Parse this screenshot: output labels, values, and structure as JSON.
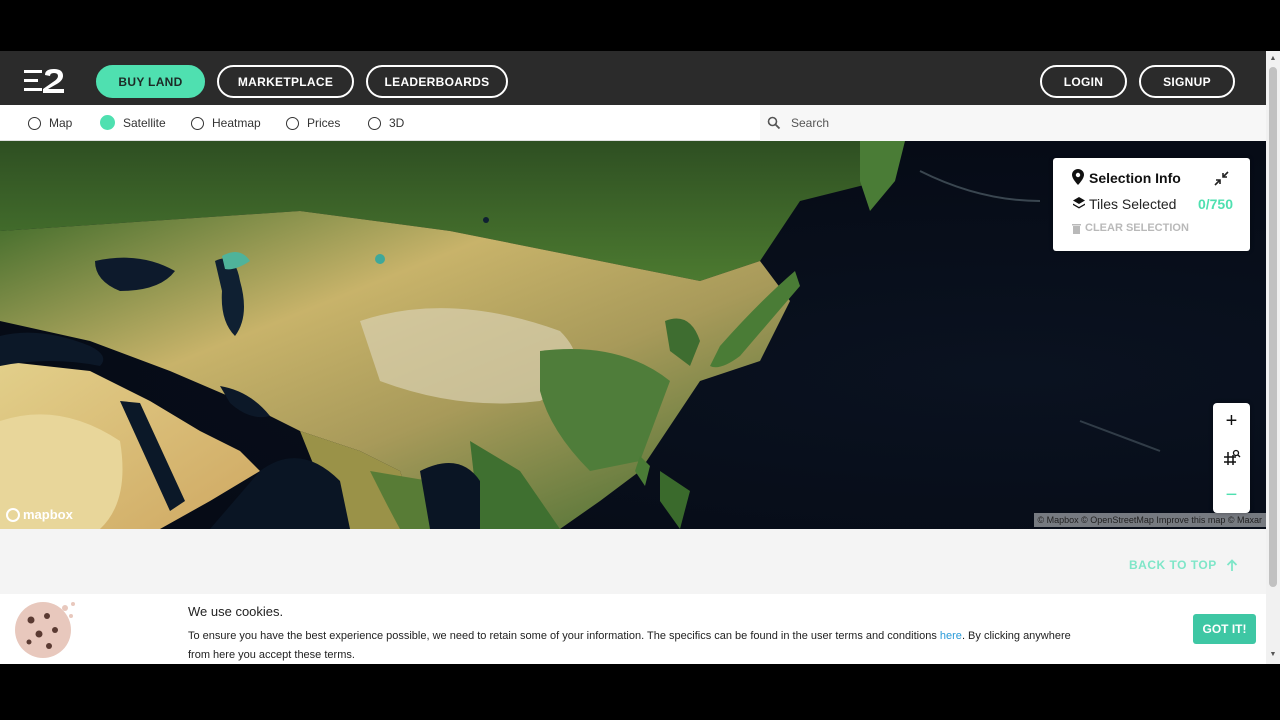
{
  "header": {
    "logo_icon": "e2-logo-icon",
    "nav": [
      {
        "label": "BUY LAND"
      },
      {
        "label": "MARKETPLACE"
      },
      {
        "label": "LEADERBOARDS"
      }
    ],
    "login_label": "LOGIN",
    "signup_label": "SIGNUP"
  },
  "toolbar": {
    "modes": [
      {
        "label": "Map",
        "selected": false
      },
      {
        "label": "Satellite",
        "selected": true
      },
      {
        "label": "Heatmap",
        "selected": false
      },
      {
        "label": "Prices",
        "selected": false
      },
      {
        "label": "3D",
        "selected": false
      }
    ],
    "search_placeholder": "Search"
  },
  "selection": {
    "title": "Selection Info",
    "tiles_label": "Tiles Selected",
    "tiles_count": "0/750",
    "clear_label": "CLEAR SELECTION"
  },
  "map": {
    "brand": "mapbox",
    "attribution": "© Mapbox © OpenStreetMap Improve this map © Maxar",
    "zoom_in": "+",
    "zoom_out": "−"
  },
  "footer": {
    "back_to_top": "BACK TO TOP"
  },
  "cookie": {
    "title": "We use cookies.",
    "text_before": "To ensure you have the best experience possible, we need to retain some of your information. The specifics can be found in the user terms and conditions ",
    "link_text": "here",
    "text_after": ". By clicking anywhere from here you accept these terms.",
    "button": "GOT IT!"
  },
  "colors": {
    "accent": "#4fe0b0",
    "header_bg": "#2b2b2b",
    "link": "#2a9bd8"
  }
}
